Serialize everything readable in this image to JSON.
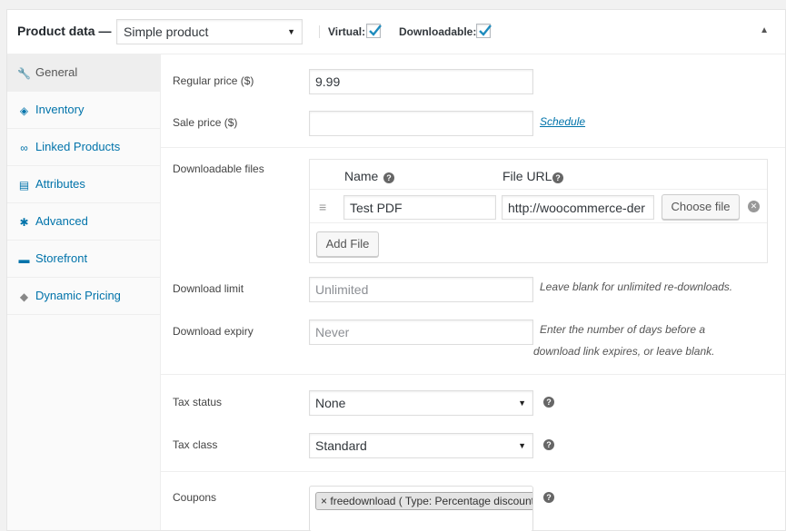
{
  "header": {
    "title": "Product data —",
    "product_type": "Simple product",
    "virtual_label": "Virtual:",
    "virtual_checked": true,
    "downloadable_label": "Downloadable:",
    "downloadable_checked": true
  },
  "tabs": [
    {
      "label": "General",
      "icon": "wrench-icon",
      "active": true
    },
    {
      "label": "Inventory",
      "icon": "tag-icon",
      "active": false
    },
    {
      "label": "Linked Products",
      "icon": "link-icon",
      "active": false
    },
    {
      "label": "Attributes",
      "icon": "list-icon",
      "active": false
    },
    {
      "label": "Advanced",
      "icon": "gear-icon",
      "active": false
    },
    {
      "label": "Storefront",
      "icon": "store-icon",
      "active": false
    },
    {
      "label": "Dynamic Pricing",
      "icon": "price-tag-icon",
      "active": false
    }
  ],
  "pricing": {
    "regular_price_label": "Regular price ($)",
    "regular_price_value": "9.99",
    "sale_price_label": "Sale price ($)",
    "sale_price_value": "",
    "schedule_link": "Schedule"
  },
  "downloads": {
    "label": "Downloadable files",
    "name_header": "Name",
    "url_header": "File URL",
    "files": [
      {
        "name": "Test PDF",
        "url": "http://woocommerce-der"
      }
    ],
    "choose_file_button": "Choose file",
    "add_file_button": "Add File",
    "limit_label": "Download limit",
    "limit_placeholder": "Unlimited",
    "limit_hint": "Leave blank for unlimited re-downloads.",
    "expiry_label": "Download expiry",
    "expiry_placeholder": "Never",
    "expiry_hint_line1": "Enter the number of days before a",
    "expiry_hint_line2": "download link expires, or leave blank."
  },
  "tax": {
    "status_label": "Tax status",
    "status_value": "None",
    "class_label": "Tax class",
    "class_value": "Standard"
  },
  "coupons": {
    "label": "Coupons",
    "chip_text": "freedownload ( Type: Percentage discount",
    "chip_remove": "×"
  },
  "colors": {
    "accent": "#0073aa",
    "active_tab_bg": "#eeeeee",
    "checkbox_check": "#1e8cbe"
  }
}
